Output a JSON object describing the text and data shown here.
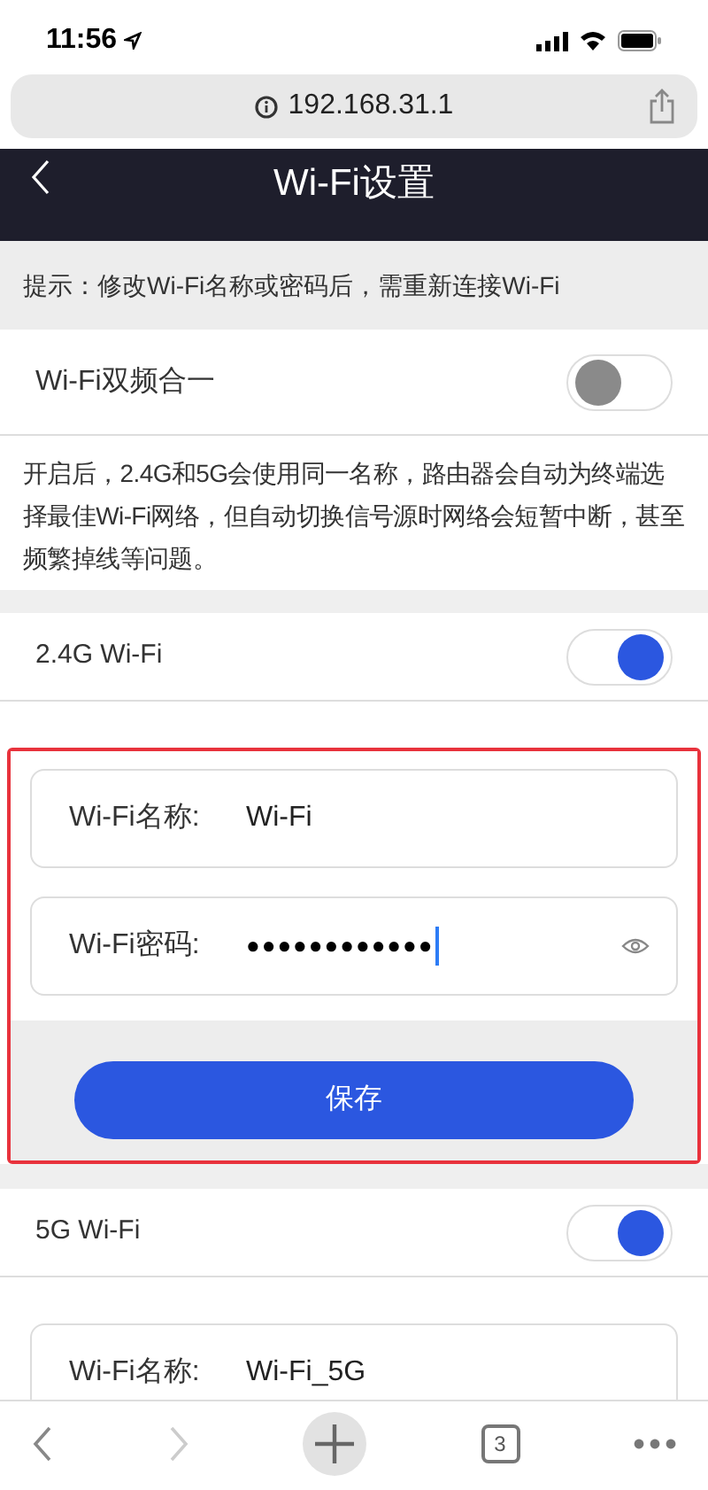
{
  "status_bar": {
    "time": "11:56"
  },
  "browser": {
    "url": "192.168.31.1",
    "tab_count": "3"
  },
  "header": {
    "title": "Wi-Fi设置"
  },
  "hint": "提示：修改Wi-Fi名称或密码后，需重新连接Wi-Fi",
  "dual_band": {
    "label": "Wi-Fi双频合一",
    "on": false,
    "description": "开启后，2.4G和5G会使用同一名称，路由器会自动为终端选择最佳Wi-Fi网络，但自动切换信号源时网络会短暂中断，甚至频繁掉线等问题。"
  },
  "bands": [
    {
      "name": "2.4G Wi-Fi",
      "on": true,
      "highlighted": true,
      "fields": [
        {
          "kind": "text",
          "label": "Wi-Fi名称:",
          "value": "Wi-Fi"
        },
        {
          "kind": "password",
          "label": "Wi-Fi密码:",
          "value": "●●●●●●●●●●●●"
        }
      ],
      "button": "保存"
    },
    {
      "name": "5G Wi-Fi",
      "on": true,
      "highlighted": false,
      "fields": [
        {
          "kind": "text",
          "label": "Wi-Fi名称:",
          "value": "Wi-Fi_5G"
        }
      ]
    }
  ]
}
